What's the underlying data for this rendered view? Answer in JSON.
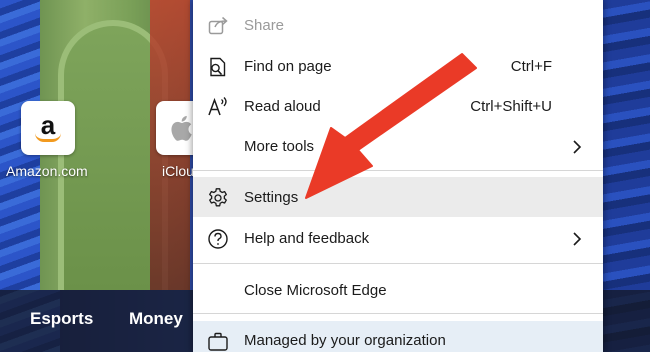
{
  "background": {
    "tiles": [
      {
        "label": "Amazon.com",
        "icon": "amazon-logo"
      },
      {
        "label": "iCloud",
        "icon": "apple-logo"
      }
    ],
    "feed_tabs": [
      "Esports",
      "Money"
    ]
  },
  "menu": {
    "items": [
      {
        "label": "Share",
        "icon": "share-icon",
        "disabled": true
      },
      {
        "label": "Find on page",
        "icon": "find-icon",
        "shortcut": "Ctrl+F"
      },
      {
        "label": "Read aloud",
        "icon": "read-aloud-icon",
        "shortcut": "Ctrl+Shift+U"
      },
      {
        "label": "More tools",
        "submenu": true
      },
      {
        "label": "Settings",
        "icon": "gear-icon",
        "highlighted": true
      },
      {
        "label": "Help and feedback",
        "icon": "question-icon",
        "submenu": true
      },
      {
        "label": "Close Microsoft Edge"
      },
      {
        "label": "Managed by your organization",
        "icon": "briefcase-icon"
      }
    ]
  },
  "annotation": {
    "color": "#ea3a27",
    "points_to": "Settings"
  }
}
